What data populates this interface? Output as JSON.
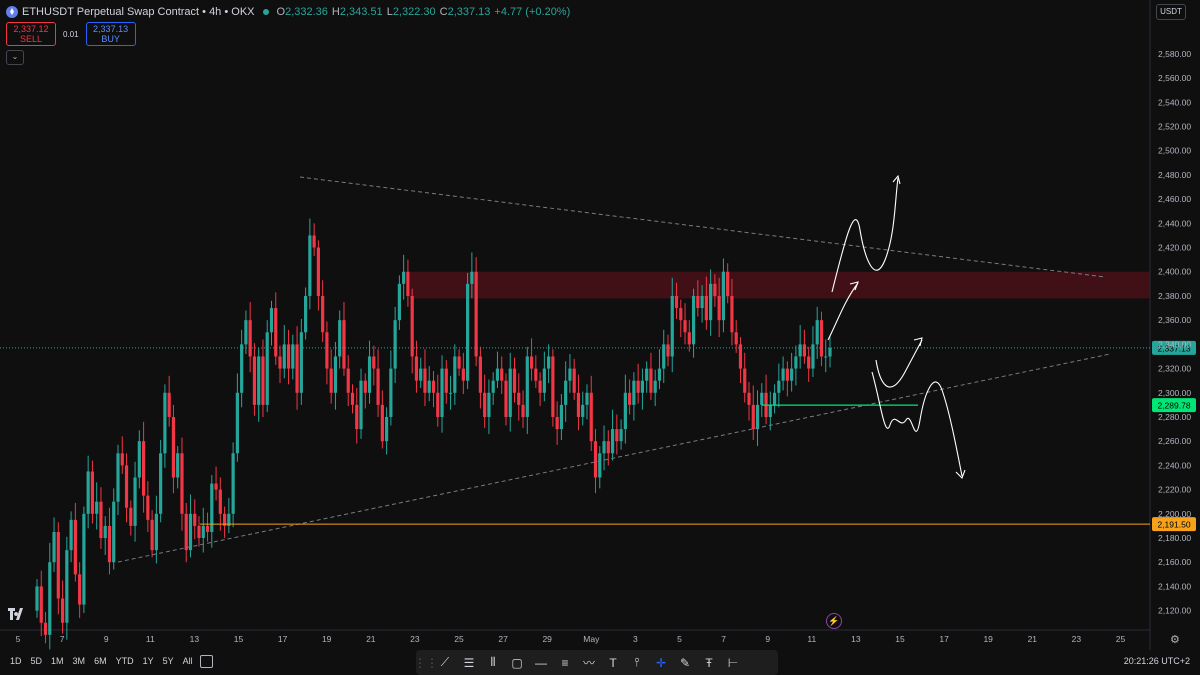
{
  "header": {
    "symbol": "ETHUSDT Perpetual Swap Contract",
    "interval": "4h",
    "exchange": "OKX",
    "open_label": "O",
    "open": "2,332.36",
    "high_label": "H",
    "high": "2,343.51",
    "low_label": "L",
    "low": "2,322.30",
    "close_label": "C",
    "close": "2,337.13",
    "change": "+4.77 (+0.20%)"
  },
  "trade": {
    "sell_price": "2,337.12",
    "sell_label": "SELL",
    "spread": "0.01",
    "buy_price": "2,337.13",
    "buy_label": "BUY"
  },
  "currency": "USDT",
  "colors": {
    "up": "#26a69a",
    "down": "#f23645",
    "background": "#0f0f0f",
    "resistance_zone": "#4a1018",
    "support_green": "#00e676",
    "support_orange": "#f7a21b"
  },
  "chart_data": {
    "type": "candlestick",
    "interval": "4h",
    "y_ticks": [
      2120,
      2140,
      2160,
      2180,
      2200,
      2220,
      2240,
      2260,
      2280,
      2300,
      2320,
      2340,
      2360,
      2380,
      2400,
      2420,
      2440,
      2460,
      2480,
      2500,
      2520,
      2540,
      2560,
      2580
    ],
    "y_tick_labels": [
      "2,120.00",
      "2,140.00",
      "2,160.00",
      "2,180.00",
      "2,200.00",
      "2,220.00",
      "2,240.00",
      "2,260.00",
      "2,280.00",
      "2,300.00",
      "2,320.00",
      "2,340.00",
      "2,360.00",
      "2,380.00",
      "2,400.00",
      "2,420.00",
      "2,440.00",
      "2,460.00",
      "2,480.00",
      "2,500.00",
      "2,520.00",
      "2,540.00",
      "2,560.00",
      "2,580.00"
    ],
    "ylim": [
      2104,
      2608
    ],
    "x_labels": [
      "5",
      "7",
      "9",
      "11",
      "13",
      "15",
      "17",
      "19",
      "21",
      "23",
      "25",
      "27",
      "29",
      "May",
      "3",
      "5",
      "7",
      "9",
      "11",
      "13",
      "15",
      "17",
      "19",
      "21",
      "23",
      "25"
    ],
    "x_label_positions": [
      0,
      2,
      4,
      6,
      8,
      10,
      12,
      14,
      16,
      18,
      20,
      22,
      24,
      26,
      28,
      30,
      32,
      34,
      36,
      38,
      40,
      42,
      44,
      46,
      48,
      50
    ],
    "closes": [
      2140,
      2110,
      2100,
      2160,
      2185,
      2130,
      2110,
      2170,
      2195,
      2150,
      2125,
      2200,
      2235,
      2200,
      2210,
      2180,
      2190,
      2160,
      2210,
      2250,
      2240,
      2205,
      2190,
      2230,
      2260,
      2215,
      2195,
      2170,
      2200,
      2250,
      2300,
      2280,
      2230,
      2250,
      2200,
      2170,
      2200,
      2190,
      2180,
      2190,
      2185,
      2225,
      2220,
      2200,
      2190,
      2200,
      2250,
      2300,
      2340,
      2360,
      2330,
      2290,
      2330,
      2290,
      2350,
      2370,
      2330,
      2320,
      2340,
      2320,
      2340,
      2300,
      2350,
      2380,
      2430,
      2420,
      2380,
      2350,
      2320,
      2300,
      2330,
      2360,
      2320,
      2300,
      2290,
      2270,
      2310,
      2300,
      2330,
      2320,
      2290,
      2260,
      2280,
      2320,
      2360,
      2390,
      2400,
      2380,
      2330,
      2310,
      2320,
      2300,
      2310,
      2300,
      2280,
      2320,
      2300,
      2300,
      2330,
      2320,
      2310,
      2390,
      2400,
      2330,
      2300,
      2280,
      2300,
      2310,
      2320,
      2310,
      2280,
      2320,
      2300,
      2290,
      2280,
      2330,
      2320,
      2310,
      2300,
      2320,
      2330,
      2280,
      2270,
      2290,
      2310,
      2320,
      2300,
      2280,
      2290,
      2300,
      2260,
      2230,
      2250,
      2260,
      2250,
      2270,
      2260,
      2270,
      2300,
      2290,
      2310,
      2300,
      2310,
      2320,
      2300,
      2310,
      2320,
      2340,
      2330,
      2380,
      2370,
      2360,
      2350,
      2340,
      2380,
      2370,
      2380,
      2360,
      2390,
      2380,
      2360,
      2400,
      2380,
      2350,
      2340,
      2320,
      2300,
      2290,
      2270,
      2290,
      2300,
      2280,
      2290,
      2300,
      2310,
      2320,
      2310,
      2320,
      2330,
      2340,
      2330,
      2320,
      2340,
      2360,
      2330,
      2330,
      2337
    ],
    "series": [],
    "levels": [
      {
        "price": 2337.13,
        "label": "2,337.13",
        "color": "#26a69a"
      },
      {
        "price": 2289.78,
        "label": "2,289.78",
        "color": "#00e676"
      },
      {
        "price": 2191.5,
        "label": "2,191.50",
        "color": "#f7a21b"
      }
    ],
    "resistance_zone": [
      2378,
      2400
    ]
  },
  "bottom": {
    "ranges": [
      "1D",
      "5D",
      "1M",
      "3M",
      "6M",
      "YTD",
      "1Y",
      "5Y",
      "All"
    ],
    "time": "20:21:26 UTC+2"
  }
}
